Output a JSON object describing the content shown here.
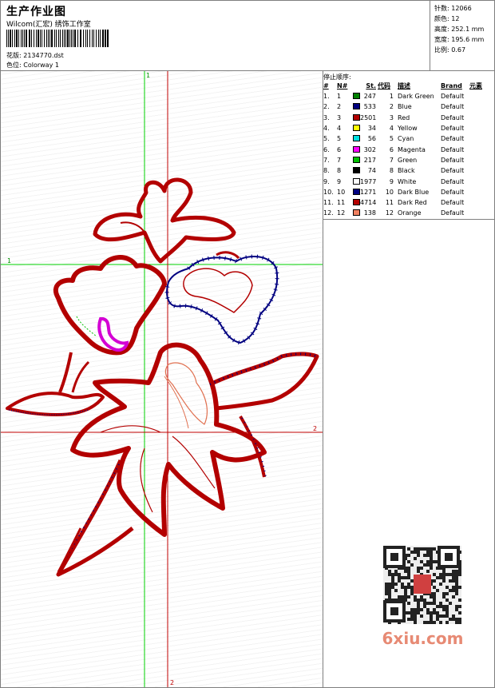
{
  "header": {
    "title": "生产作业图",
    "company": "Wilcom(汇宏)  绣饰工作室",
    "barcode_text": "",
    "design_file_label": "花版:",
    "design_file": "2134770.dst",
    "colorway_label": "色位:",
    "colorway": "Colorway 1"
  },
  "stats": [
    {
      "label": "针数:",
      "value": "12066"
    },
    {
      "label": "颜色:",
      "value": "12"
    },
    {
      "label": "高度:",
      "value": "252.1 mm"
    },
    {
      "label": "宽度:",
      "value": "195.6 mm"
    },
    {
      "label": "比例:",
      "value": "0.67"
    }
  ],
  "canvas": {
    "marker_top": "1",
    "marker_left": "1",
    "marker_right": "2",
    "marker_bottom": "2",
    "colors": {
      "red": "#b30000",
      "blue": "#000080",
      "magenta": "#d400d4",
      "green_axis": "#00d000",
      "red_axis": "#c00000",
      "orange": "#e07050"
    }
  },
  "stop_sequence": {
    "title": "停止顺序:",
    "headers": [
      "#",
      "N#",
      "St.",
      "代码",
      "描述",
      "Brand",
      "元素"
    ],
    "rows": [
      {
        "n": "1.",
        "nn": "1",
        "color": "#008000",
        "st": "247",
        "code": "1",
        "desc": "Dark Green",
        "brand": "Default"
      },
      {
        "n": "2.",
        "nn": "2",
        "color": "#000080",
        "st": "533",
        "code": "2",
        "desc": "Blue",
        "brand": "Default"
      },
      {
        "n": "3.",
        "nn": "3",
        "color": "#b30000",
        "st": "2501",
        "code": "3",
        "desc": "Red",
        "brand": "Default"
      },
      {
        "n": "4.",
        "nn": "4",
        "color": "#ffff00",
        "st": "34",
        "code": "4",
        "desc": "Yellow",
        "brand": "Default"
      },
      {
        "n": "5.",
        "nn": "5",
        "color": "#00e0e0",
        "st": "56",
        "code": "5",
        "desc": "Cyan",
        "brand": "Default"
      },
      {
        "n": "6.",
        "nn": "6",
        "color": "#ff00ff",
        "st": "302",
        "code": "6",
        "desc": "Magenta",
        "brand": "Default"
      },
      {
        "n": "7.",
        "nn": "7",
        "color": "#00c000",
        "st": "217",
        "code": "7",
        "desc": "Green",
        "brand": "Default"
      },
      {
        "n": "8.",
        "nn": "8",
        "color": "#000000",
        "st": "74",
        "code": "8",
        "desc": "Black",
        "brand": "Default"
      },
      {
        "n": "9.",
        "nn": "9",
        "color": "#ffffff",
        "st": "1977",
        "code": "9",
        "desc": "White",
        "brand": "Default"
      },
      {
        "n": "10.",
        "nn": "10",
        "color": "#000080",
        "st": "1271",
        "code": "10",
        "desc": "Dark Blue",
        "brand": "Default"
      },
      {
        "n": "11.",
        "nn": "11",
        "color": "#b30000",
        "st": "4714",
        "code": "11",
        "desc": "Dark Red",
        "brand": "Default"
      },
      {
        "n": "12.",
        "nn": "12",
        "color": "#f08060",
        "st": "138",
        "code": "12",
        "desc": "Orange",
        "brand": "Default"
      }
    ]
  },
  "watermark": {
    "text": "6xiu.com",
    "seal_text": "印章"
  }
}
